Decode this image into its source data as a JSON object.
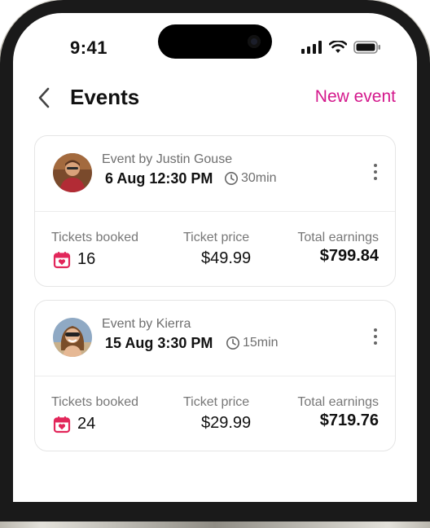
{
  "status_bar": {
    "time": "9:41"
  },
  "header": {
    "title": "Events",
    "action_label": "New event"
  },
  "labels": {
    "tickets": "Tickets booked",
    "price": "Ticket price",
    "earnings": "Total earnings"
  },
  "events": [
    {
      "byline": "Event by Justin Gouse",
      "datetime": "6 Aug 12:30 PM",
      "duration": "30min",
      "tickets": "16",
      "price": "$49.99",
      "earnings": "$799.84"
    },
    {
      "byline": "Event by Kierra",
      "datetime": "15 Aug 3:30 PM",
      "duration": "15min",
      "tickets": "24",
      "price": "$29.99",
      "earnings": "$719.76"
    }
  ],
  "colors": {
    "accent": "#d4188c",
    "calendar_icon": "#e2265a"
  }
}
